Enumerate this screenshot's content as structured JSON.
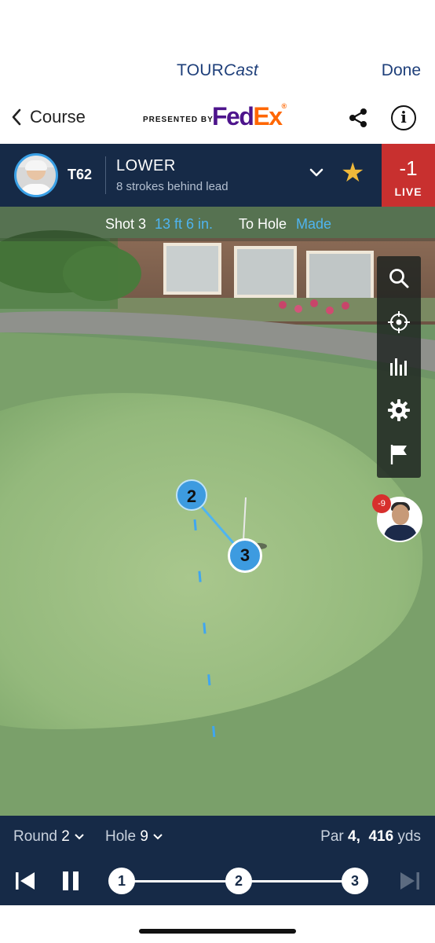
{
  "header": {
    "title_main": "TOUR",
    "title_italic": "Cast",
    "done_label": "Done",
    "back_label": "Course",
    "presented_by": "PRESENTED BY",
    "sponsor_part1": "Fed",
    "sponsor_part2": "Ex",
    "sponsor_mark": "®"
  },
  "player": {
    "position": "T62",
    "name": "LOWER",
    "status": "8 strokes behind lead",
    "score": "-1",
    "live_label": "LIVE"
  },
  "shot": {
    "label": "Shot 3",
    "distance": "13 ft 6 in.",
    "to_hole_label": "To Hole",
    "result": "Made"
  },
  "markers": {
    "shot_2": "2",
    "shot_3": "3",
    "other_player_score": "-9"
  },
  "footer": {
    "round_label": "Round",
    "round_value": "2",
    "hole_label": "Hole",
    "hole_value": "9",
    "par_label": "Par",
    "par_value": "4,",
    "yards_value": "416",
    "yards_unit": "yds",
    "timeline": [
      "1",
      "2",
      "3"
    ]
  },
  "icons": [
    "chevron-left-icon",
    "share-icon",
    "info-icon",
    "chevron-down-icon",
    "star-icon",
    "search-icon",
    "crosshair-icon",
    "bar-chart-icon",
    "gear-icon",
    "flag-icon",
    "skip-back-icon",
    "pause-icon",
    "skip-forward-icon"
  ],
  "colors": {
    "navy": "#162a47",
    "live_red": "#c8302f",
    "accent_blue": "#4fb4f0",
    "star_gold": "#f0b93a"
  }
}
